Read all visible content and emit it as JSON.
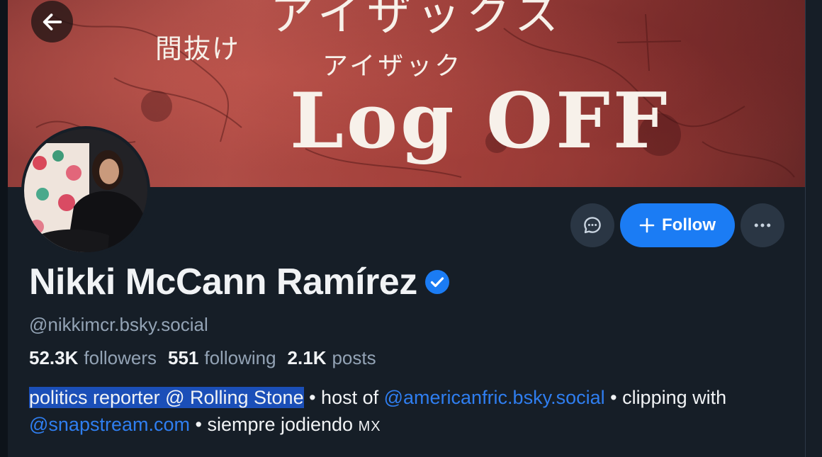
{
  "banner": {
    "top_text": "アイザックス",
    "jp_small": "間抜け",
    "jp_sub": "アイザック",
    "title": "Log OFF"
  },
  "profile": {
    "display_name": "Nikki McCann Ramírez",
    "handle": "@nikkimcr.bsky.social",
    "stats": [
      {
        "value": "52.3K",
        "label": "followers"
      },
      {
        "value": "551",
        "label": "following"
      },
      {
        "value": "2.1K",
        "label": "posts"
      }
    ],
    "bio": {
      "selected": "politics reporter @ Rolling Stone",
      "sep1": " • host of ",
      "link1": "@americanfric.bsky.social",
      "sep2": " • clipping with ",
      "link2": "@snapstream.com",
      "sep3": " • siempre jodiendo ",
      "suffix": "MX"
    }
  },
  "actions": {
    "follow_label": "Follow"
  },
  "icons": {
    "back": "arrow-left-icon",
    "message": "chat-bubble-icon",
    "follow": "plus-icon",
    "more": "ellipsis-icon",
    "verified": "verified-check-icon"
  },
  "colors": {
    "accent": "#1b7cf4",
    "background": "#161e27",
    "link": "#2f7ef0",
    "selection": "#1b4fb8"
  }
}
